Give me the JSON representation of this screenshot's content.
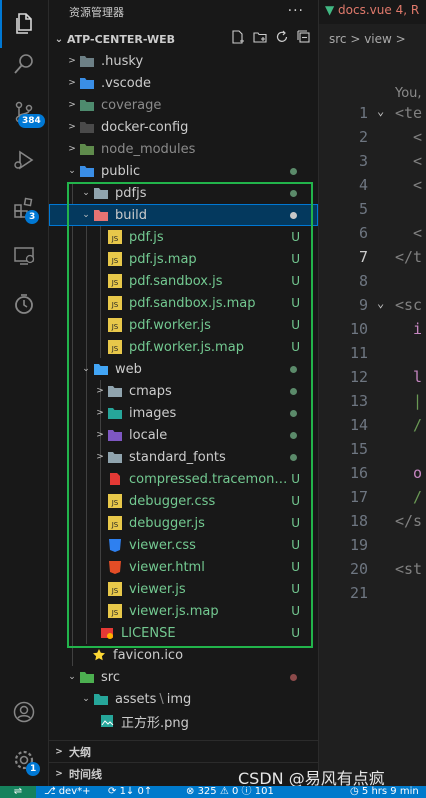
{
  "activity": {
    "scm_badge": "384",
    "ext_badge": "3",
    "account_badge": "1"
  },
  "sidebar": {
    "title": "资源管理器",
    "more": "···",
    "workspace": "ATP-CENTER-WEB",
    "items": [
      {
        "label": ".husky",
        "status": "",
        "dim": false
      },
      {
        "label": ".vscode",
        "status": "",
        "dim": false
      },
      {
        "label": "coverage",
        "status": "",
        "dim": true
      },
      {
        "label": "docker-config",
        "status": "",
        "dim": false
      },
      {
        "label": "node_modules",
        "status": "",
        "dim": true
      },
      {
        "label": "public",
        "status": "",
        "dim": false
      },
      {
        "label": "pdfjs",
        "status": "",
        "dim": false
      },
      {
        "label": "build",
        "status": "",
        "dim": false
      },
      {
        "label": "pdf.js",
        "status": "U"
      },
      {
        "label": "pdf.js.map",
        "status": "U"
      },
      {
        "label": "pdf.sandbox.js",
        "status": "U"
      },
      {
        "label": "pdf.sandbox.js.map",
        "status": "U"
      },
      {
        "label": "pdf.worker.js",
        "status": "U"
      },
      {
        "label": "pdf.worker.js.map",
        "status": "U"
      },
      {
        "label": "web",
        "status": ""
      },
      {
        "label": "cmaps",
        "status": ""
      },
      {
        "label": "images",
        "status": ""
      },
      {
        "label": "locale",
        "status": ""
      },
      {
        "label": "standard_fonts",
        "status": ""
      },
      {
        "label": "compressed.tracemonkey...",
        "status": "U"
      },
      {
        "label": "debugger.css",
        "status": "U"
      },
      {
        "label": "debugger.js",
        "status": "U"
      },
      {
        "label": "viewer.css",
        "status": "U"
      },
      {
        "label": "viewer.html",
        "status": "U"
      },
      {
        "label": "viewer.js",
        "status": "U"
      },
      {
        "label": "viewer.js.map",
        "status": "U"
      },
      {
        "label": "LICENSE",
        "status": "U"
      },
      {
        "label": "favicon.ico",
        "status": ""
      },
      {
        "label": "src",
        "status": ""
      },
      {
        "label": "assets",
        "label2": "img",
        "status": ""
      },
      {
        "label": "正方形.png",
        "status": ""
      }
    ],
    "outline_label": "大纲",
    "timeline_label": "时间线"
  },
  "editor": {
    "tab_label": "docs.vue 4, R",
    "breadcrumb": "src > view >",
    "codelens": "You,",
    "lines": [
      {
        "num": "1",
        "code": "<te",
        "fold": "⌄"
      },
      {
        "num": "2",
        "code": "  <",
        "fold": ""
      },
      {
        "num": "3",
        "code": "  <",
        "fold": ""
      },
      {
        "num": "4",
        "code": "  <",
        "fold": ""
      },
      {
        "num": "5",
        "code": "",
        "fold": ""
      },
      {
        "num": "6",
        "code": "  <",
        "fold": ""
      },
      {
        "num": "7",
        "code": "</t",
        "fold": ""
      },
      {
        "num": "8",
        "code": "",
        "fold": ""
      },
      {
        "num": "9",
        "code": "<sc",
        "fold": "⌄"
      },
      {
        "num": "10",
        "code": "  i",
        "fold": ""
      },
      {
        "num": "11",
        "code": "",
        "fold": ""
      },
      {
        "num": "12",
        "code": "  l",
        "fold": ""
      },
      {
        "num": "13",
        "code": "  |",
        "fold": ""
      },
      {
        "num": "14",
        "code": "  /",
        "fold": ""
      },
      {
        "num": "15",
        "code": "",
        "fold": ""
      },
      {
        "num": "16",
        "code": "  o",
        "fold": ""
      },
      {
        "num": "17",
        "code": "  /",
        "fold": ""
      },
      {
        "num": "18",
        "code": "</s",
        "fold": ""
      },
      {
        "num": "19",
        "code": "",
        "fold": ""
      },
      {
        "num": "20",
        "code": "<st",
        "fold": ""
      },
      {
        "num": "21",
        "code": "",
        "fold": ""
      }
    ],
    "current_line": "7"
  },
  "statusbar": {
    "branch": "dev*+",
    "sync": "1↓ 0↑",
    "errors": "325",
    "warnings": "0",
    "info": "101",
    "time": "5 hrs 9 min"
  },
  "watermark": "CSDN @易风有点疯",
  "colors": {
    "accent": "#0078d4",
    "untracked": "#73c991",
    "highlight_box": "#22b44b",
    "status_bar": "#007acc"
  }
}
